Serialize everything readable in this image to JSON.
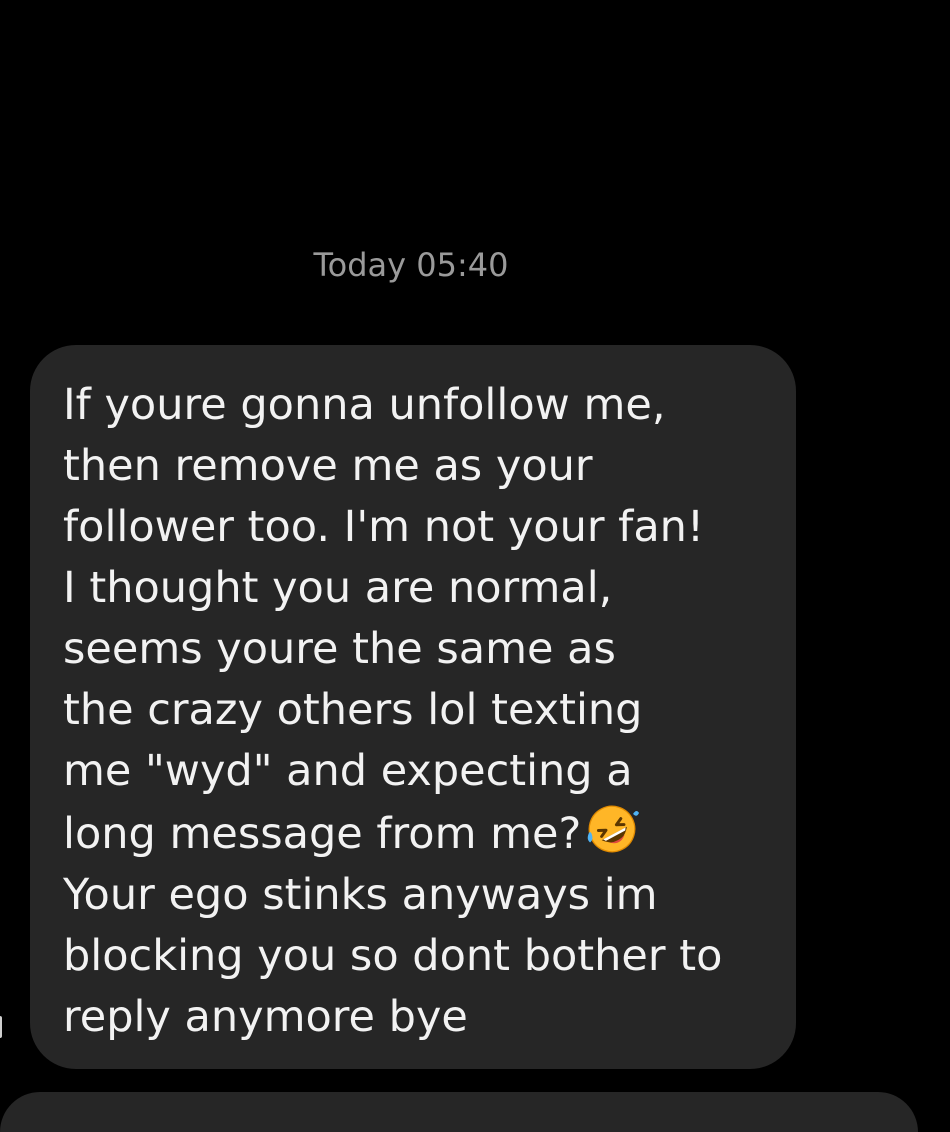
{
  "conversation": {
    "timestamp": "Today 05:40",
    "message": {
      "lines": [
        "If youre gonna unfollow me,",
        "then remove me as your",
        "follower too. I'm not your fan!",
        "I thought you are normal,",
        "seems youre the same as",
        "the crazy others lol texting",
        "me \"wyd\" and expecting a",
        "long message from me?",
        "Your ego stinks anyways im",
        "blocking you so dont bother to",
        "reply anymore bye"
      ],
      "emoji": "rolling-on-floor-laughing-emoji"
    }
  },
  "colors": {
    "background": "#000000",
    "bubble": "#262626",
    "text": "#f2f2f2",
    "timestamp": "#9a9a9a"
  }
}
